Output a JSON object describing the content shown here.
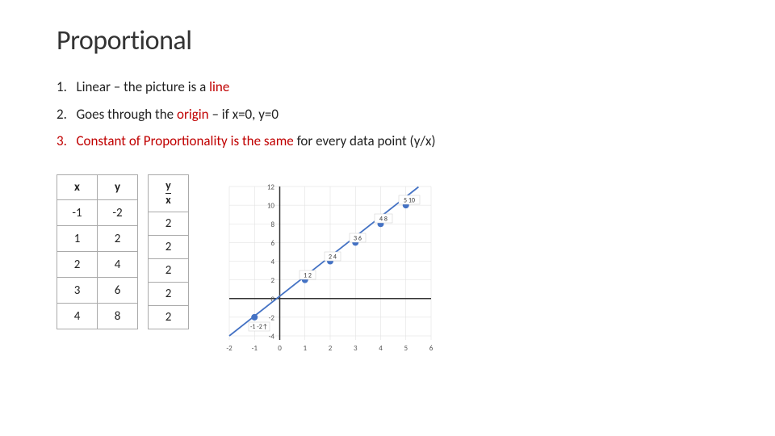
{
  "title": "Proportional",
  "points": [
    {
      "number": "1.",
      "prefix": "Linear – the picture is a ",
      "highlight": "line",
      "highlight_color": "red",
      "suffix": "",
      "number_color": "black"
    },
    {
      "number": "2.",
      "prefix": "Goes through the ",
      "highlight": "origin",
      "highlight_color": "red",
      "suffix": " – if x=0, y=0",
      "number_color": "black"
    },
    {
      "number": "3.",
      "prefix": "Constant of Proportionality is the ",
      "highlight": "same",
      "highlight_color": "red",
      "suffix": " for every data point (y/x)",
      "prefix_color": "red",
      "number_color": "red"
    }
  ],
  "table1": {
    "headers": [
      "x",
      "y"
    ],
    "rows": [
      [
        "-1",
        "-2"
      ],
      [
        "1",
        "2"
      ],
      [
        "2",
        "4"
      ],
      [
        "3",
        "6"
      ],
      [
        "4",
        "8"
      ]
    ]
  },
  "table2": {
    "header_top": "y",
    "header_bottom": "x",
    "rows": [
      "2",
      "2",
      "2",
      "2",
      "2"
    ]
  },
  "chart": {
    "x_min": -2,
    "x_max": 6,
    "y_min": -4,
    "y_max": 12,
    "line_points": [
      [
        -1,
        -2
      ],
      [
        1,
        2
      ],
      [
        2,
        4
      ],
      [
        3,
        6
      ],
      [
        4,
        8
      ],
      [
        5,
        10
      ]
    ],
    "data_labels": [
      {
        "x": -1,
        "y": -2,
        "label": "-1 -2↑"
      },
      {
        "x": 1,
        "y": 2,
        "label": "1 2"
      },
      {
        "x": 2,
        "y": 4,
        "label": "2 4"
      },
      {
        "x": 3,
        "y": 6,
        "label": "3 6"
      },
      {
        "x": 4,
        "y": 8,
        "label": "4 8"
      },
      {
        "x": 5,
        "y": 10,
        "label": "5 10"
      }
    ]
  }
}
